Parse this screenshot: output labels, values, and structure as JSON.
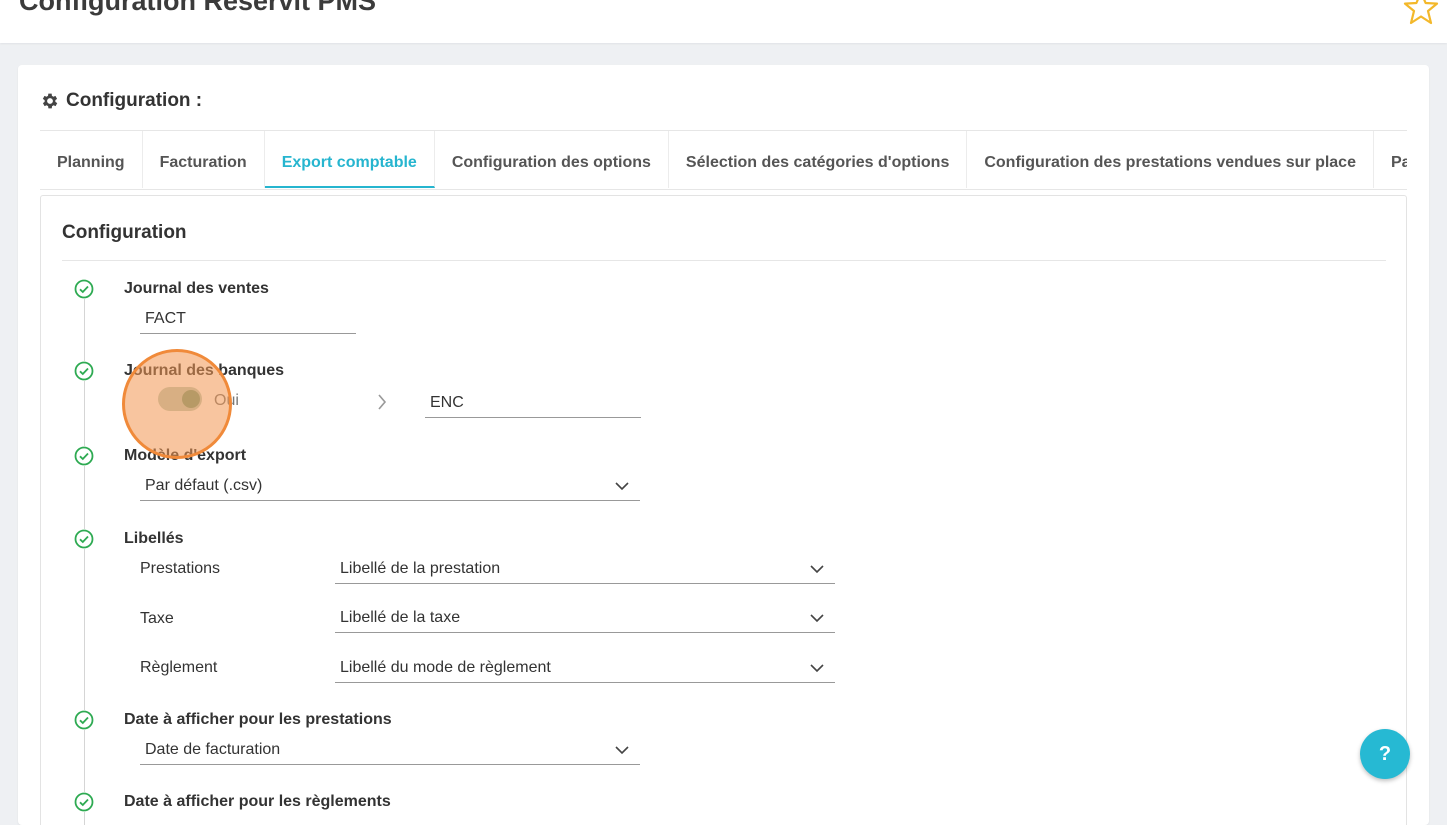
{
  "header": {
    "title": "Configuration Reservit PMS",
    "favorite_icon": "star-icon"
  },
  "card": {
    "title": "Configuration :",
    "icon": "gear-icon"
  },
  "tabs": [
    {
      "label": "Planning"
    },
    {
      "label": "Facturation"
    },
    {
      "label": "Export comptable",
      "active": true
    },
    {
      "label": "Configuration des options"
    },
    {
      "label": "Sélection des catégories d'options"
    },
    {
      "label": "Configuration des prestations vendues sur place"
    },
    {
      "label": "Partenaires"
    }
  ],
  "panel": {
    "title": "Configuration",
    "journal_ventes": {
      "label": "Journal des ventes",
      "value": "FACT"
    },
    "journal_banques": {
      "label": "Journal des banques",
      "toggle_label": "Oui",
      "toggle_on": true,
      "value": "ENC"
    },
    "modele_export": {
      "label": "Modèle d'export",
      "value": "Par défaut (.csv)"
    },
    "libelles": {
      "label": "Libellés",
      "rows": [
        {
          "label": "Prestations",
          "value": "Libellé de la prestation"
        },
        {
          "label": "Taxe",
          "value": "Libellé de la taxe"
        },
        {
          "label": "Règlement",
          "value": "Libellé du mode de règlement"
        }
      ]
    },
    "date_prestations": {
      "label": "Date à afficher pour les prestations",
      "value": "Date de facturation"
    },
    "date_reglements": {
      "label": "Date à afficher pour les règlements"
    }
  },
  "help": {
    "label": "?"
  },
  "colors": {
    "accent": "#26b5cf",
    "success": "#2eaa52",
    "click_indicator": "#f08a3a"
  }
}
